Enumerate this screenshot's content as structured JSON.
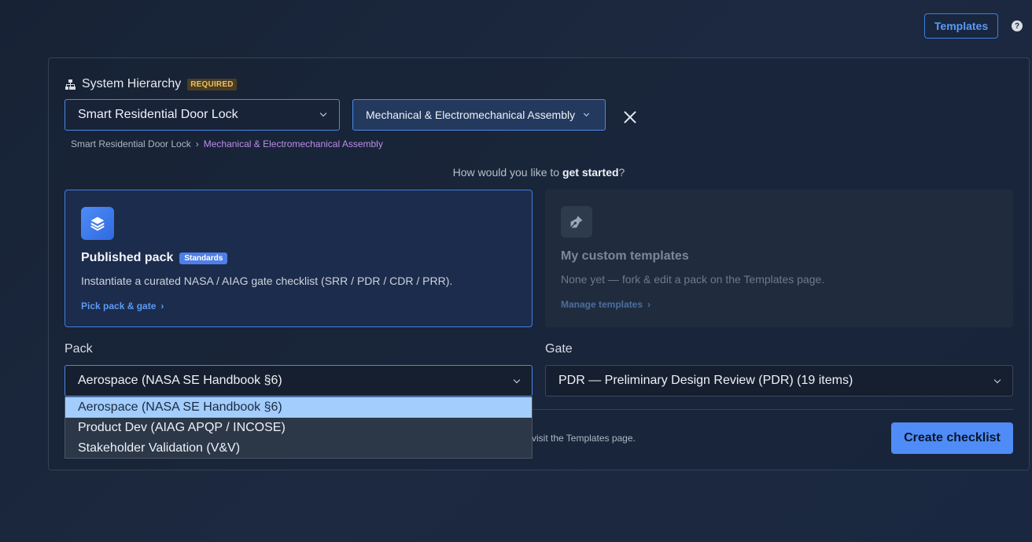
{
  "header": {
    "templates_label": "Templates",
    "help_glyph": "?"
  },
  "hierarchy": {
    "title": "System Hierarchy",
    "required_badge": "REQUIRED",
    "product_value": "Smart Residential Door Lock",
    "assembly_value": "Mechanical & Electromechanical Assembly",
    "breadcrumb": [
      "Smart Residential Door Lock",
      "Mechanical & Electromechanical Assembly"
    ]
  },
  "prompt": {
    "prefix": "How would you like to ",
    "bold": "get started",
    "suffix": "?"
  },
  "cards": {
    "pack": {
      "title": "Published pack",
      "badge": "Standards",
      "description": "Instantiate a curated NASA / AIAG gate checklist (SRR / PDR / CDR / PRR).",
      "link": "Pick pack & gate"
    },
    "custom": {
      "title": "My custom templates",
      "description": "None yet — fork & edit a pack on the Templates page.",
      "link": "Manage templates"
    }
  },
  "pack_select": {
    "label": "Pack",
    "value": "Aerospace (NASA SE Handbook §6)",
    "options": [
      "Aerospace (NASA SE Handbook §6)",
      "Product Dev (AIAG APQP / INCOSE)",
      "Stakeholder Validation (V&V)"
    ]
  },
  "gate_select": {
    "label": "Gate",
    "value": "PDR — Preliminary Design Review (PDR) (19 items)"
  },
  "footer": {
    "note": "visit the Templates page.",
    "create_label": "Create checklist"
  },
  "colors": {
    "accent": "#4f8cf7",
    "required_badge": "#f0c060",
    "breadcrumb_active": "#b98ee8"
  },
  "icons": {
    "hierarchy": "sitemap-icon",
    "pack": "layers-icon",
    "custom": "pen-icon",
    "close": "close-icon"
  }
}
